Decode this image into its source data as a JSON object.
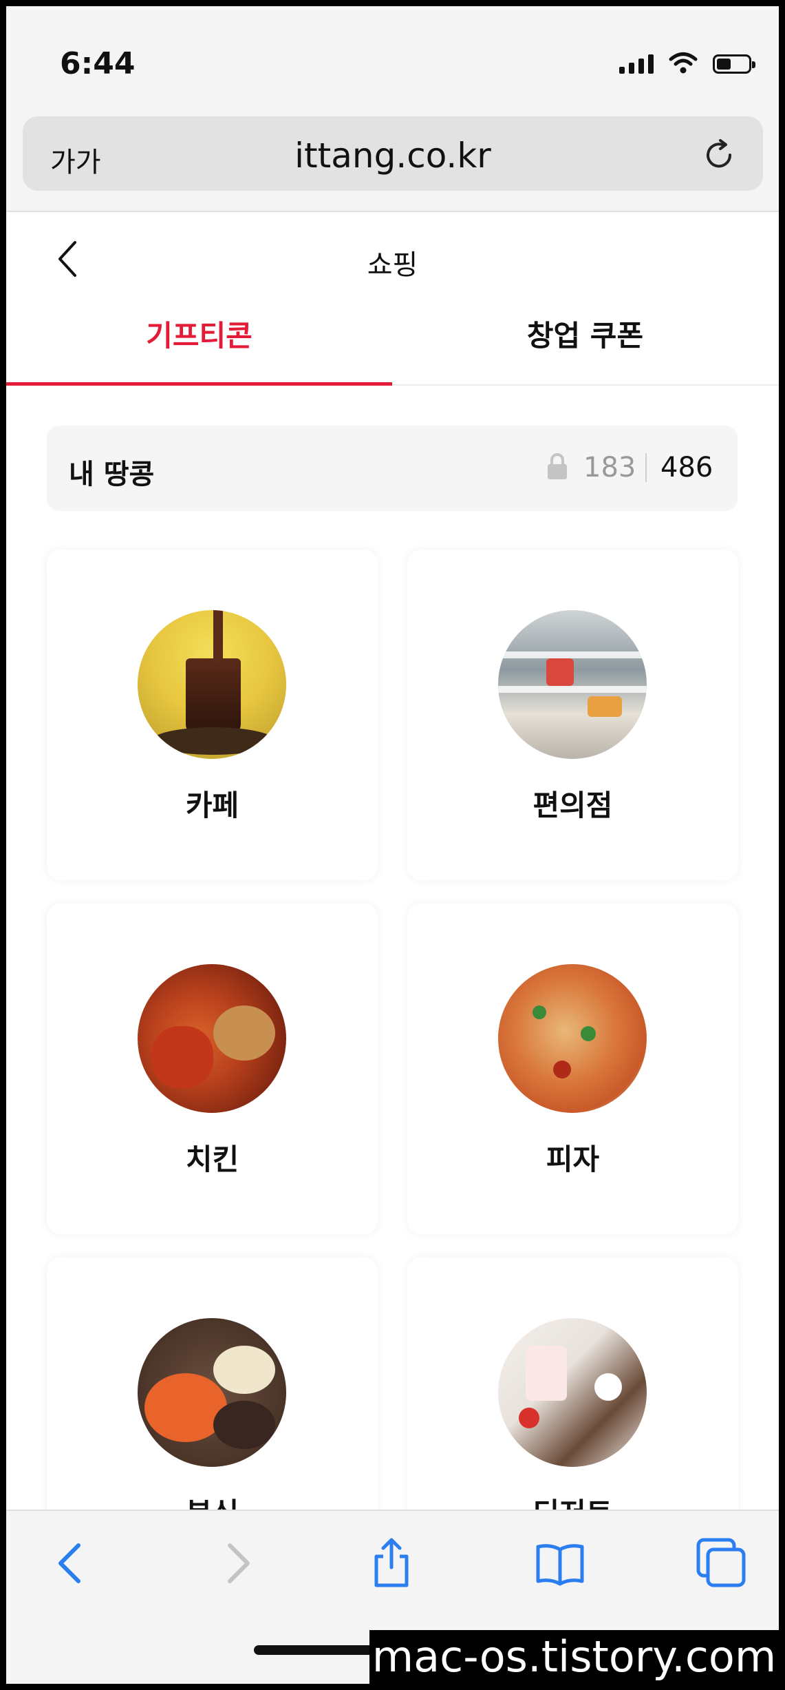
{
  "status_bar": {
    "time": "6:44",
    "battery_fraction": 0.4
  },
  "browser": {
    "text_size_label": "가가",
    "url": "ittang.co.kr"
  },
  "header": {
    "title": "쇼핑"
  },
  "tabs": [
    {
      "label": "기프티콘",
      "active": true
    },
    {
      "label": "창업 쿠폰",
      "active": false
    }
  ],
  "points": {
    "label": "내 땅콩",
    "locked": "183",
    "available": "486"
  },
  "categories": [
    {
      "label": "카페",
      "image": "iced-coffee-photo"
    },
    {
      "label": "편의점",
      "image": "convenience-store-photo"
    },
    {
      "label": "치킨",
      "image": "fried-chicken-photo"
    },
    {
      "label": "피자",
      "image": "pizza-photo"
    },
    {
      "label": "분식",
      "image": "tteokbokki-photo"
    },
    {
      "label": "디저트",
      "image": "dessert-photo"
    }
  ],
  "watermark": "mac-os.tistory.com",
  "colors": {
    "accent": "#e31b36",
    "ios_blue": "#2a7ef0",
    "disabled": "#c4c4c4"
  }
}
